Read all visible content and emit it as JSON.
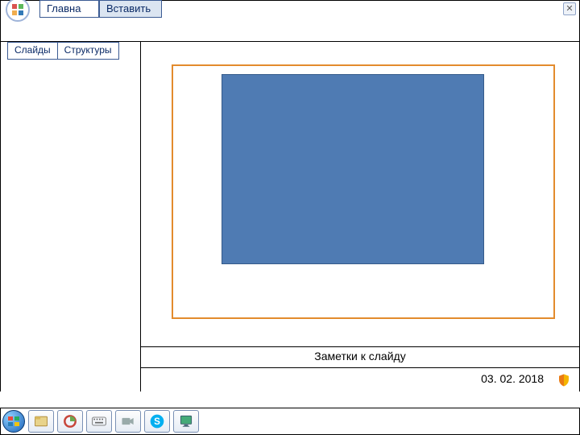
{
  "ribbon": {
    "tabs": [
      "Главна",
      "Вставить"
    ],
    "selected_index": 1
  },
  "panel": {
    "tabs": [
      "Слайды",
      "Структуры"
    ]
  },
  "notes": {
    "label": "Заметки к слайду"
  },
  "status": {
    "date": "03. 02. 2018"
  },
  "taskbar_icons": [
    "start",
    "explorer",
    "chart",
    "keyboard",
    "video",
    "skype",
    "monitor"
  ]
}
